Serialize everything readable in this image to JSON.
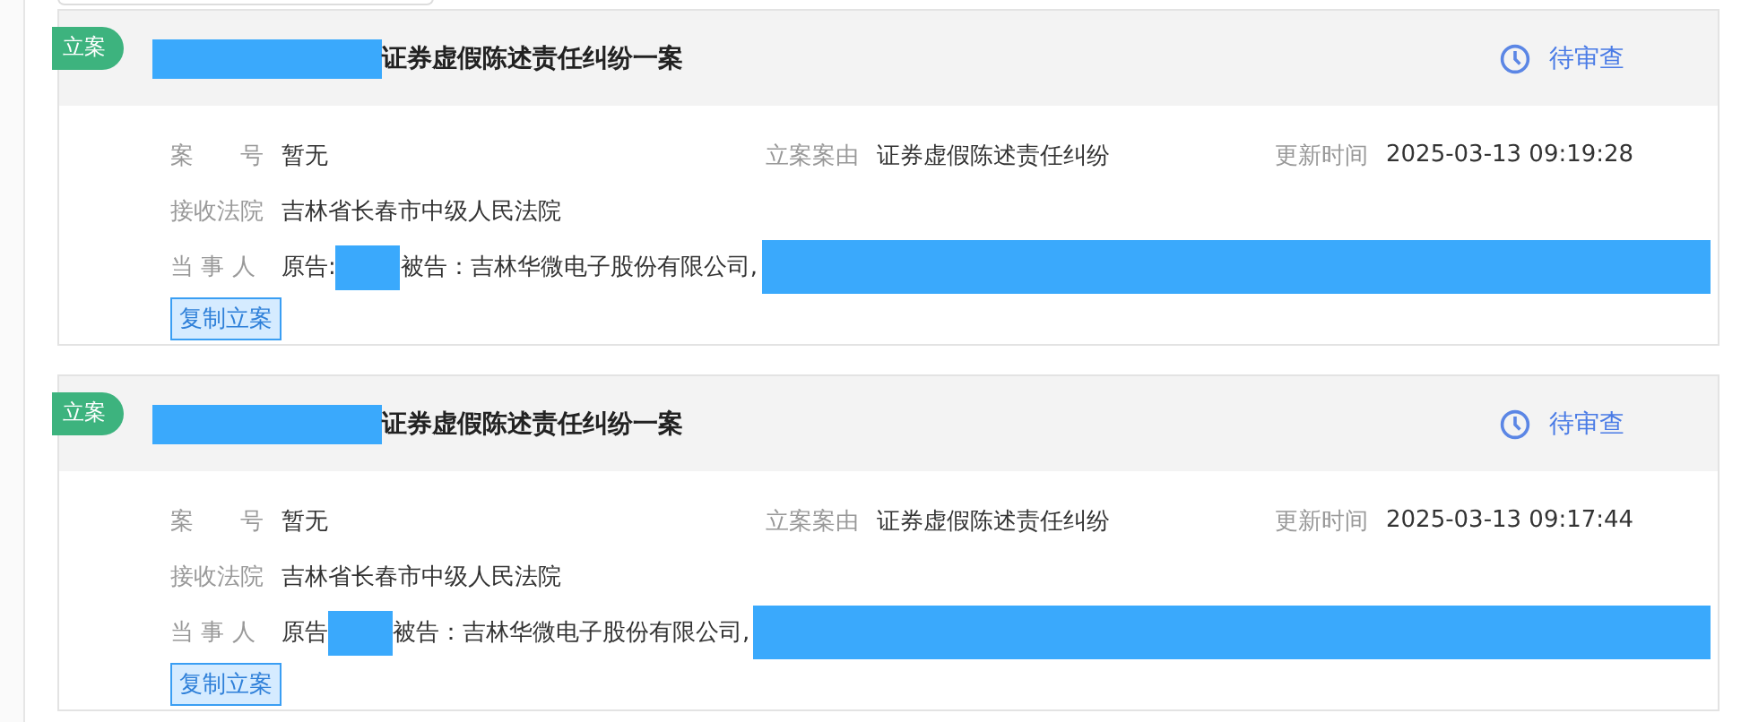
{
  "cases": [
    {
      "tag": "立案",
      "title": "证券虚假陈述责任纠纷一案",
      "status": "待审查",
      "case_no_label": "案　　号",
      "case_no": "暂无",
      "cause_label": "立案案由",
      "cause": "证券虚假陈述责任纠纷",
      "updated_label": "更新时间",
      "updated": "2025-03-13 09:19:28",
      "court_label": "接收法院",
      "court": "吉林省长春市中级人民法院",
      "parties_label": "当 事 人",
      "plaintiff_label": "原告:",
      "defendant": "被告：吉林华微电子股份有限公司,",
      "copy_button": "复制立案"
    },
    {
      "tag": "立案",
      "title": "证券虚假陈述责任纠纷一案",
      "status": "待审查",
      "case_no_label": "案　　号",
      "case_no": "暂无",
      "cause_label": "立案案由",
      "cause": "证券虚假陈述责任纠纷",
      "updated_label": "更新时间",
      "updated": "2025-03-13 09:17:44",
      "court_label": "接收法院",
      "court": "吉林省长春市中级人民法院",
      "parties_label": "当 事 人",
      "plaintiff_label": "原告",
      "defendant": "被告：吉林华微电子股份有限公司,",
      "copy_button": "复制立案"
    }
  ]
}
